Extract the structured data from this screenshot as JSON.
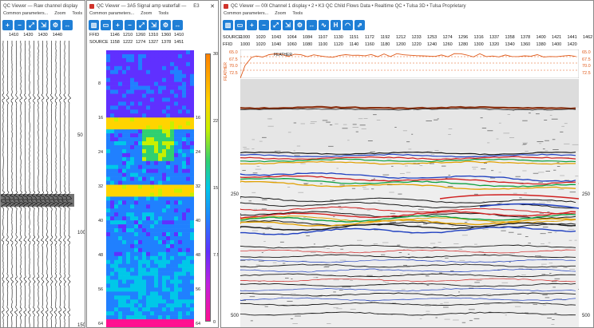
{
  "windows": {
    "left": {
      "title": "QC Viewer — Raw channel display",
      "menu": [
        "Common parameters...",
        "Zoom",
        "Tools"
      ],
      "header_values": [
        "1410",
        "1420",
        "1430",
        "1440"
      ],
      "depth_labels": [
        "50",
        "100",
        "150"
      ]
    },
    "middle": {
      "title": "QC Viewer — 3A5 Signal amp waterfall —",
      "title_extra": "E3",
      "menu": [
        "Common parameters...",
        "Zoom",
        "Tools"
      ],
      "row1_label": "FFID",
      "row1_values": [
        "1146",
        "1210",
        "1260",
        "1310",
        "1360",
        "1410"
      ],
      "row2_label": "SOURCE",
      "row2_values": [
        "1158",
        "1222",
        "1274",
        "1327",
        "1378",
        "1451"
      ],
      "left_axis": [
        "8",
        "16",
        "24",
        "32",
        "40",
        "48",
        "56",
        "64"
      ],
      "right_axis": [
        "16",
        "24",
        "32",
        "40",
        "48",
        "56",
        "64"
      ],
      "colorbar_labels": [
        "30",
        "22.5",
        "15",
        "7.5",
        "0"
      ]
    },
    "right": {
      "title": "QC Viewer — 00l Channel 1 display • 2 • K3 QC Child Flows Data • Realtime QC • Tulsa 3D • Tulsa Proprietary",
      "menu": [
        "Common parameters...",
        "Zoom",
        "Tools"
      ],
      "source_label": "SOURCE",
      "source_values": [
        "1000",
        "1020",
        "1043",
        "1064",
        "1084",
        "1107",
        "1130",
        "1151",
        "1172",
        "1192",
        "1212",
        "1233",
        "1253",
        "1274",
        "1296",
        "1316",
        "1337",
        "1358",
        "1378",
        "1400",
        "1421",
        "1441",
        "1462"
      ],
      "ffid_label": "FFID",
      "ffid_values": [
        "1000",
        "1020",
        "1040",
        "1060",
        "1080",
        "1100",
        "1120",
        "1140",
        "1160",
        "1180",
        "1200",
        "1220",
        "1240",
        "1260",
        "1280",
        "1300",
        "1320",
        "1340",
        "1360",
        "1380",
        "1400",
        "1420"
      ],
      "feather_label": "FEATHER",
      "plot_label": "FEATHER",
      "plot_y_labels": [
        "65.0",
        "67.5",
        "70.0",
        "72.5"
      ],
      "depth_labels": [
        "250",
        "500"
      ]
    }
  },
  "colors": {
    "accent": "#1f7fd6",
    "feather": "#e05a1a"
  }
}
